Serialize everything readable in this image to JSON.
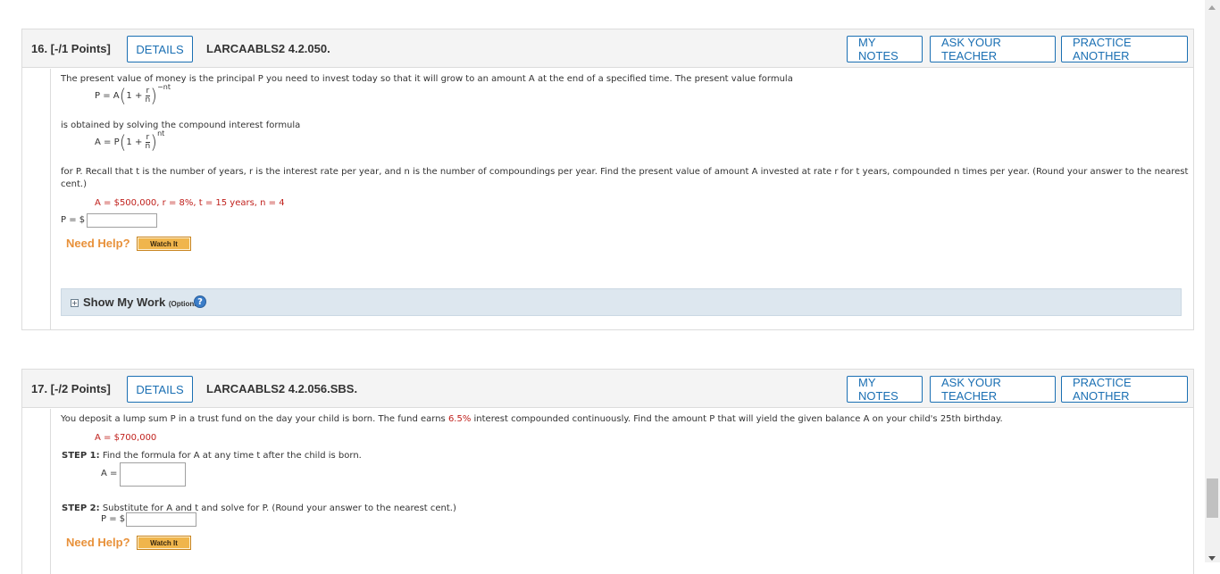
{
  "q16": {
    "number": "16. [-/1 Points]",
    "details": "DETAILS",
    "code": "LARCAABLS2 4.2.050.",
    "my_notes": "MY NOTES",
    "ask_teacher": "ASK YOUR TEACHER",
    "practice": "PRACTICE ANOTHER",
    "intro": "The present value of money is the principal P you need to invest today so that it will grow to an amount A at the end of a specified time. The present value formula",
    "formula1": {
      "lhs": "P = A",
      "inner": "1 +",
      "num": "r",
      "den": "n",
      "exp": "−nt"
    },
    "obtained": "is obtained by solving the compound interest formula",
    "formula2": {
      "lhs": "A = P",
      "inner": "1 +",
      "num": "r",
      "den": "n",
      "exp": "nt"
    },
    "instructions_line1": "for P. Recall that t is the number of years, r is the interest rate per year, and n is the number of compoundings per year. Find the present value of amount A invested at rate r for t years, compounded n times per year. (Round your answer to the nearest",
    "instructions_line2": "cent.)",
    "given": "A = $500,000, r = 8%, t = 15 years, n = 4",
    "answer_label": "P = $",
    "need_help": "Need Help?",
    "watch_it": "Watch It",
    "show_work": "Show My Work",
    "optional": "(Optional)",
    "help_icon": "?"
  },
  "q17": {
    "number": "17. [-/2 Points]",
    "details": "DETAILS",
    "code": "LARCAABLS2 4.2.056.SBS.",
    "my_notes": "MY NOTES",
    "ask_teacher": "ASK YOUR TEACHER",
    "practice": "PRACTICE ANOTHER",
    "intro_pre": "You deposit a lump sum P in a trust fund on the day your child is born. The fund earns ",
    "rate": "6.5%",
    "intro_post": " interest compounded continuously. Find the amount P that will yield the given balance A on your child's 25th birthday.",
    "given": "A = $700,000",
    "step1_label": "STEP 1:",
    "step1_text": "Find the formula for A at any time t after the child is born.",
    "step1_answer_label": "A =",
    "step2_label": "STEP 2:",
    "step2_text": "Substitute for A and t and solve for P. (Round your answer to the nearest cent.)",
    "step2_answer_label": "P = $",
    "need_help": "Need Help?",
    "watch_it": "Watch It"
  },
  "colors": {
    "accent": "#1a6fb3",
    "help": "#e8913a",
    "highlight": "#c0211d",
    "show_work_bg": "#dde7ef"
  }
}
